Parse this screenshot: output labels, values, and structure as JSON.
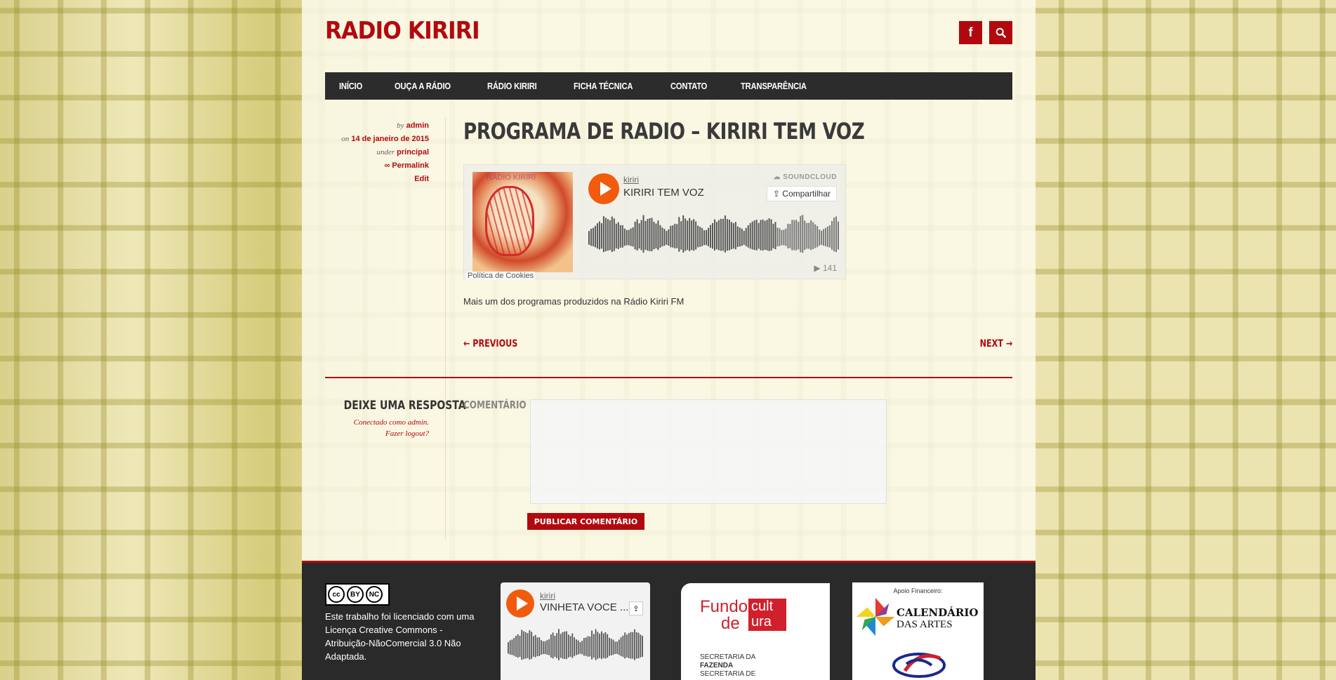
{
  "header": {
    "site_title": "RADIO KIRIRI",
    "facebook_icon_glyph": "f",
    "icons": [
      "facebook-icon",
      "search-icon"
    ]
  },
  "nav": {
    "items": [
      "INÍCIO",
      "OUÇA A RÁDIO",
      "RÁDIO KIRIRI",
      "FICHA TÉCNICA",
      "CONTATO",
      "TRANSPARÊNCIA"
    ]
  },
  "post_meta": {
    "by_label": "by",
    "author": "admin",
    "on_label": "on",
    "date": "14 de janeiro de 2015",
    "under_label": "under",
    "category": "principal",
    "permalink": "∞ Permalink",
    "edit": "Edit"
  },
  "post": {
    "title": "PROGRAMA DE RADIO – KIRIRI TEM VOZ",
    "excerpt": "Mais um dos programas produzidos na Rádio Kiriri FM",
    "prev": "← PREVIOUS",
    "next": "NEXT →"
  },
  "soundcloud": {
    "art_label": "RÁDIO KIRIRI",
    "user": "kiriri",
    "track": "KIRIRI TEM VOZ",
    "brand": "SOUNDCLOUD",
    "share": "Compartilhar",
    "plays": "▶ 141",
    "cookie_link": "Política de Cookies"
  },
  "reply": {
    "heading": "DEIXE UMA RESPOSTA",
    "logged_in": "Conectado como admin.",
    "logout": "Fazer logout?",
    "comment_label": "COMENTÁRIO",
    "comment_value": "",
    "submit": "PUBLICAR COMENTÁRIO"
  },
  "footer": {
    "cc_by": "BY",
    "cc_nc": "NC",
    "license_text": "Este trabalho foi licenciado com uma Licença Creative Commons - Atribuição-NãoComercial 3.0 Não Adaptada.",
    "mini_player": {
      "user": "kiriri",
      "track": "VINHETA VOCE ..."
    },
    "fundo": {
      "line1": "Fundo",
      "line2": "de",
      "block_line1": "cult",
      "block_line2": "ura",
      "sec1": "SECRETARIA DA",
      "sec2": "FAZENDA",
      "sec3": "SECRETARIA DE"
    },
    "calendario": {
      "apoio": "Apoio Financeiro:",
      "title1": "CALENDÁRIO",
      "title2": "DAS ARTES"
    }
  },
  "colors": {
    "brand_red": "#b2090f",
    "nav_bg": "#2c2c2c",
    "soundcloud_orange": "#f25b0c",
    "footer_bg": "#2a2a2a"
  }
}
